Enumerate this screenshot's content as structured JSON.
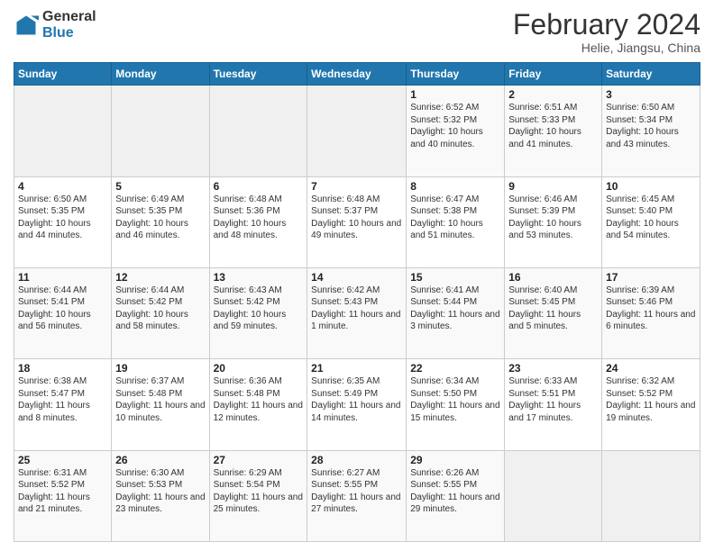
{
  "header": {
    "logo_general": "General",
    "logo_blue": "Blue",
    "title": "February 2024",
    "subtitle": "Helie, Jiangsu, China"
  },
  "days_of_week": [
    "Sunday",
    "Monday",
    "Tuesday",
    "Wednesday",
    "Thursday",
    "Friday",
    "Saturday"
  ],
  "weeks": [
    [
      {
        "day": "",
        "sunrise": "",
        "sunset": "",
        "daylight": ""
      },
      {
        "day": "",
        "sunrise": "",
        "sunset": "",
        "daylight": ""
      },
      {
        "day": "",
        "sunrise": "",
        "sunset": "",
        "daylight": ""
      },
      {
        "day": "",
        "sunrise": "",
        "sunset": "",
        "daylight": ""
      },
      {
        "day": "1",
        "sunrise": "Sunrise: 6:52 AM",
        "sunset": "Sunset: 5:32 PM",
        "daylight": "Daylight: 10 hours and 40 minutes."
      },
      {
        "day": "2",
        "sunrise": "Sunrise: 6:51 AM",
        "sunset": "Sunset: 5:33 PM",
        "daylight": "Daylight: 10 hours and 41 minutes."
      },
      {
        "day": "3",
        "sunrise": "Sunrise: 6:50 AM",
        "sunset": "Sunset: 5:34 PM",
        "daylight": "Daylight: 10 hours and 43 minutes."
      }
    ],
    [
      {
        "day": "4",
        "sunrise": "Sunrise: 6:50 AM",
        "sunset": "Sunset: 5:35 PM",
        "daylight": "Daylight: 10 hours and 44 minutes."
      },
      {
        "day": "5",
        "sunrise": "Sunrise: 6:49 AM",
        "sunset": "Sunset: 5:35 PM",
        "daylight": "Daylight: 10 hours and 46 minutes."
      },
      {
        "day": "6",
        "sunrise": "Sunrise: 6:48 AM",
        "sunset": "Sunset: 5:36 PM",
        "daylight": "Daylight: 10 hours and 48 minutes."
      },
      {
        "day": "7",
        "sunrise": "Sunrise: 6:48 AM",
        "sunset": "Sunset: 5:37 PM",
        "daylight": "Daylight: 10 hours and 49 minutes."
      },
      {
        "day": "8",
        "sunrise": "Sunrise: 6:47 AM",
        "sunset": "Sunset: 5:38 PM",
        "daylight": "Daylight: 10 hours and 51 minutes."
      },
      {
        "day": "9",
        "sunrise": "Sunrise: 6:46 AM",
        "sunset": "Sunset: 5:39 PM",
        "daylight": "Daylight: 10 hours and 53 minutes."
      },
      {
        "day": "10",
        "sunrise": "Sunrise: 6:45 AM",
        "sunset": "Sunset: 5:40 PM",
        "daylight": "Daylight: 10 hours and 54 minutes."
      }
    ],
    [
      {
        "day": "11",
        "sunrise": "Sunrise: 6:44 AM",
        "sunset": "Sunset: 5:41 PM",
        "daylight": "Daylight: 10 hours and 56 minutes."
      },
      {
        "day": "12",
        "sunrise": "Sunrise: 6:44 AM",
        "sunset": "Sunset: 5:42 PM",
        "daylight": "Daylight: 10 hours and 58 minutes."
      },
      {
        "day": "13",
        "sunrise": "Sunrise: 6:43 AM",
        "sunset": "Sunset: 5:42 PM",
        "daylight": "Daylight: 10 hours and 59 minutes."
      },
      {
        "day": "14",
        "sunrise": "Sunrise: 6:42 AM",
        "sunset": "Sunset: 5:43 PM",
        "daylight": "Daylight: 11 hours and 1 minute."
      },
      {
        "day": "15",
        "sunrise": "Sunrise: 6:41 AM",
        "sunset": "Sunset: 5:44 PM",
        "daylight": "Daylight: 11 hours and 3 minutes."
      },
      {
        "day": "16",
        "sunrise": "Sunrise: 6:40 AM",
        "sunset": "Sunset: 5:45 PM",
        "daylight": "Daylight: 11 hours and 5 minutes."
      },
      {
        "day": "17",
        "sunrise": "Sunrise: 6:39 AM",
        "sunset": "Sunset: 5:46 PM",
        "daylight": "Daylight: 11 hours and 6 minutes."
      }
    ],
    [
      {
        "day": "18",
        "sunrise": "Sunrise: 6:38 AM",
        "sunset": "Sunset: 5:47 PM",
        "daylight": "Daylight: 11 hours and 8 minutes."
      },
      {
        "day": "19",
        "sunrise": "Sunrise: 6:37 AM",
        "sunset": "Sunset: 5:48 PM",
        "daylight": "Daylight: 11 hours and 10 minutes."
      },
      {
        "day": "20",
        "sunrise": "Sunrise: 6:36 AM",
        "sunset": "Sunset: 5:48 PM",
        "daylight": "Daylight: 11 hours and 12 minutes."
      },
      {
        "day": "21",
        "sunrise": "Sunrise: 6:35 AM",
        "sunset": "Sunset: 5:49 PM",
        "daylight": "Daylight: 11 hours and 14 minutes."
      },
      {
        "day": "22",
        "sunrise": "Sunrise: 6:34 AM",
        "sunset": "Sunset: 5:50 PM",
        "daylight": "Daylight: 11 hours and 15 minutes."
      },
      {
        "day": "23",
        "sunrise": "Sunrise: 6:33 AM",
        "sunset": "Sunset: 5:51 PM",
        "daylight": "Daylight: 11 hours and 17 minutes."
      },
      {
        "day": "24",
        "sunrise": "Sunrise: 6:32 AM",
        "sunset": "Sunset: 5:52 PM",
        "daylight": "Daylight: 11 hours and 19 minutes."
      }
    ],
    [
      {
        "day": "25",
        "sunrise": "Sunrise: 6:31 AM",
        "sunset": "Sunset: 5:52 PM",
        "daylight": "Daylight: 11 hours and 21 minutes."
      },
      {
        "day": "26",
        "sunrise": "Sunrise: 6:30 AM",
        "sunset": "Sunset: 5:53 PM",
        "daylight": "Daylight: 11 hours and 23 minutes."
      },
      {
        "day": "27",
        "sunrise": "Sunrise: 6:29 AM",
        "sunset": "Sunset: 5:54 PM",
        "daylight": "Daylight: 11 hours and 25 minutes."
      },
      {
        "day": "28",
        "sunrise": "Sunrise: 6:27 AM",
        "sunset": "Sunset: 5:55 PM",
        "daylight": "Daylight: 11 hours and 27 minutes."
      },
      {
        "day": "29",
        "sunrise": "Sunrise: 6:26 AM",
        "sunset": "Sunset: 5:55 PM",
        "daylight": "Daylight: 11 hours and 29 minutes."
      },
      {
        "day": "",
        "sunrise": "",
        "sunset": "",
        "daylight": ""
      },
      {
        "day": "",
        "sunrise": "",
        "sunset": "",
        "daylight": ""
      }
    ]
  ]
}
